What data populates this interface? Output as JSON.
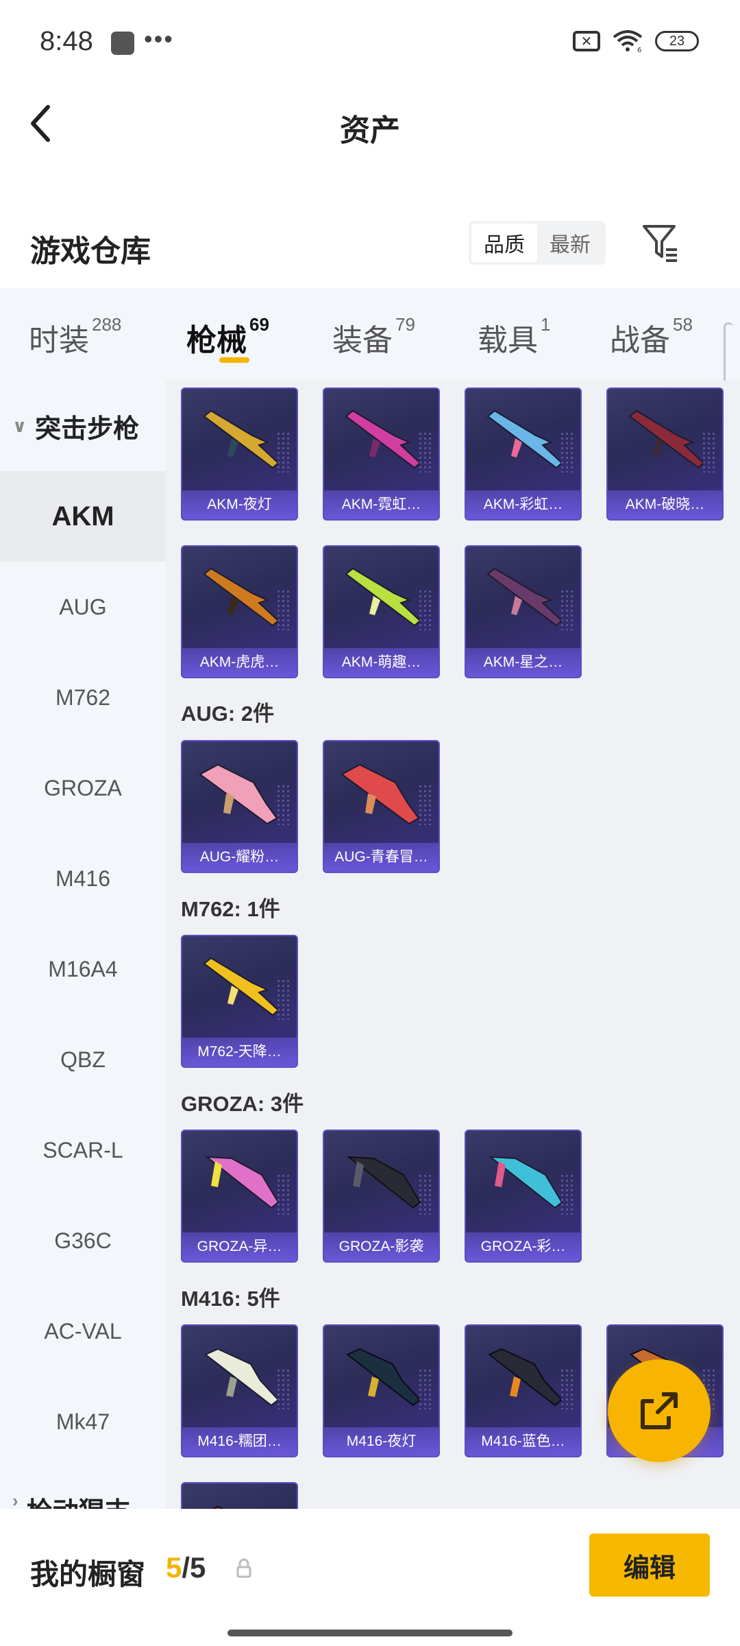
{
  "status_bar": {
    "time": "8:48",
    "dots": "•••",
    "sim_icon": "✕",
    "wifi_badge": "6",
    "battery": "23"
  },
  "nav": {
    "title": "资产"
  },
  "warehouse": {
    "title": "游戏仓库",
    "sort_options": [
      "品质",
      "最新"
    ],
    "selected_sort": "品质"
  },
  "tabs": [
    {
      "label": "时装",
      "count": "288",
      "active": false
    },
    {
      "label": "枪械",
      "count": "69",
      "active": true
    },
    {
      "label": "装备",
      "count": "79",
      "active": false
    },
    {
      "label": "载具",
      "count": "1",
      "active": false
    },
    {
      "label": "战备",
      "count": "58",
      "active": false
    }
  ],
  "sidebar": {
    "group": "突击步枪",
    "items": [
      "AKM",
      "AUG",
      "M762",
      "GROZA",
      "M416",
      "M16A4",
      "QBZ",
      "SCAR-L",
      "G36C",
      "AC-VAL",
      "Mk47"
    ],
    "active": "AKM",
    "next_group": "枪动猩支"
  },
  "sections": [
    {
      "label": "",
      "items": [
        "AKM-夜灯",
        "AKM-霓虹…",
        "AKM-彩虹…",
        "AKM-破晓…",
        "AKM-虎虎…",
        "AKM-萌趣…",
        "AKM-星之…"
      ]
    },
    {
      "label": "AUG: 2件",
      "items": [
        "AUG-耀粉…",
        "AUG-青春冒…"
      ]
    },
    {
      "label": "M762: 1件",
      "items": [
        "M762-天降…"
      ]
    },
    {
      "label": "GROZA: 3件",
      "items": [
        "GROZA-异…",
        "GROZA-影袭",
        "GROZA-彩…"
      ]
    },
    {
      "label": "M416: 5件",
      "items": [
        "M416-糯团…",
        "M416-夜灯",
        "M416-蓝色…",
        "M416-…",
        ""
      ]
    }
  ],
  "bottom": {
    "label": "我的橱窗",
    "count_current": "5",
    "count_sep_total": "/5",
    "edit_label": "编辑"
  },
  "colors": {
    "accent": "#f7b400",
    "card_bg": "#2c2c58",
    "card_label": "#6a57d8"
  }
}
